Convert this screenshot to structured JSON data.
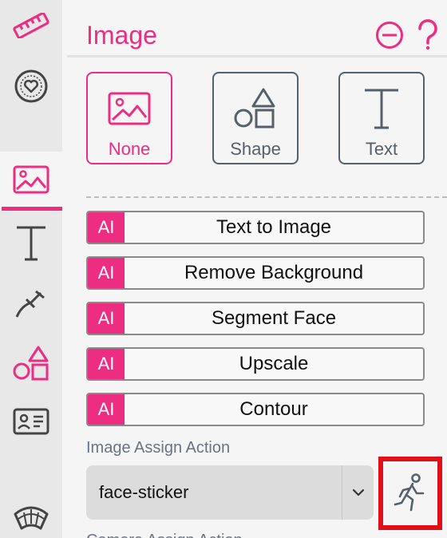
{
  "panel": {
    "title": "Image",
    "header_icons": [
      "minus-circle-icon",
      "question-icon"
    ]
  },
  "rail": {
    "items": [
      {
        "name": "ruler",
        "icon": "ruler-icon"
      },
      {
        "name": "badge",
        "icon": "heart-badge-icon"
      },
      {
        "name": "image",
        "icon": "image-icon",
        "active": true
      },
      {
        "name": "text",
        "icon": "text-icon"
      },
      {
        "name": "tools",
        "icon": "tools-icon"
      },
      {
        "name": "shapes",
        "icon": "shapes-icon"
      },
      {
        "name": "id-card",
        "icon": "id-card-icon"
      },
      {
        "name": "curved-text",
        "icon": "curved-text-icon"
      }
    ]
  },
  "image_types": [
    {
      "label": "None",
      "icon": "image-icon",
      "active": true
    },
    {
      "label": "Shape",
      "icon": "shapes-icon",
      "active": false
    },
    {
      "label": "Text",
      "icon": "text-icon",
      "active": false
    }
  ],
  "ai_actions": {
    "badge": "AI",
    "items": [
      "Text to Image",
      "Remove Background",
      "Segment Face",
      "Upscale",
      "Contour"
    ]
  },
  "assign_action": {
    "label": "Image Assign Action",
    "selected": "face-sticker",
    "run_icon": "running-person-icon"
  },
  "next_section_label": "Camera Assign Action",
  "colors": {
    "accent": "#ec2d82",
    "highlight_border": "#e0101a",
    "neutral_icon": "#55606a"
  }
}
